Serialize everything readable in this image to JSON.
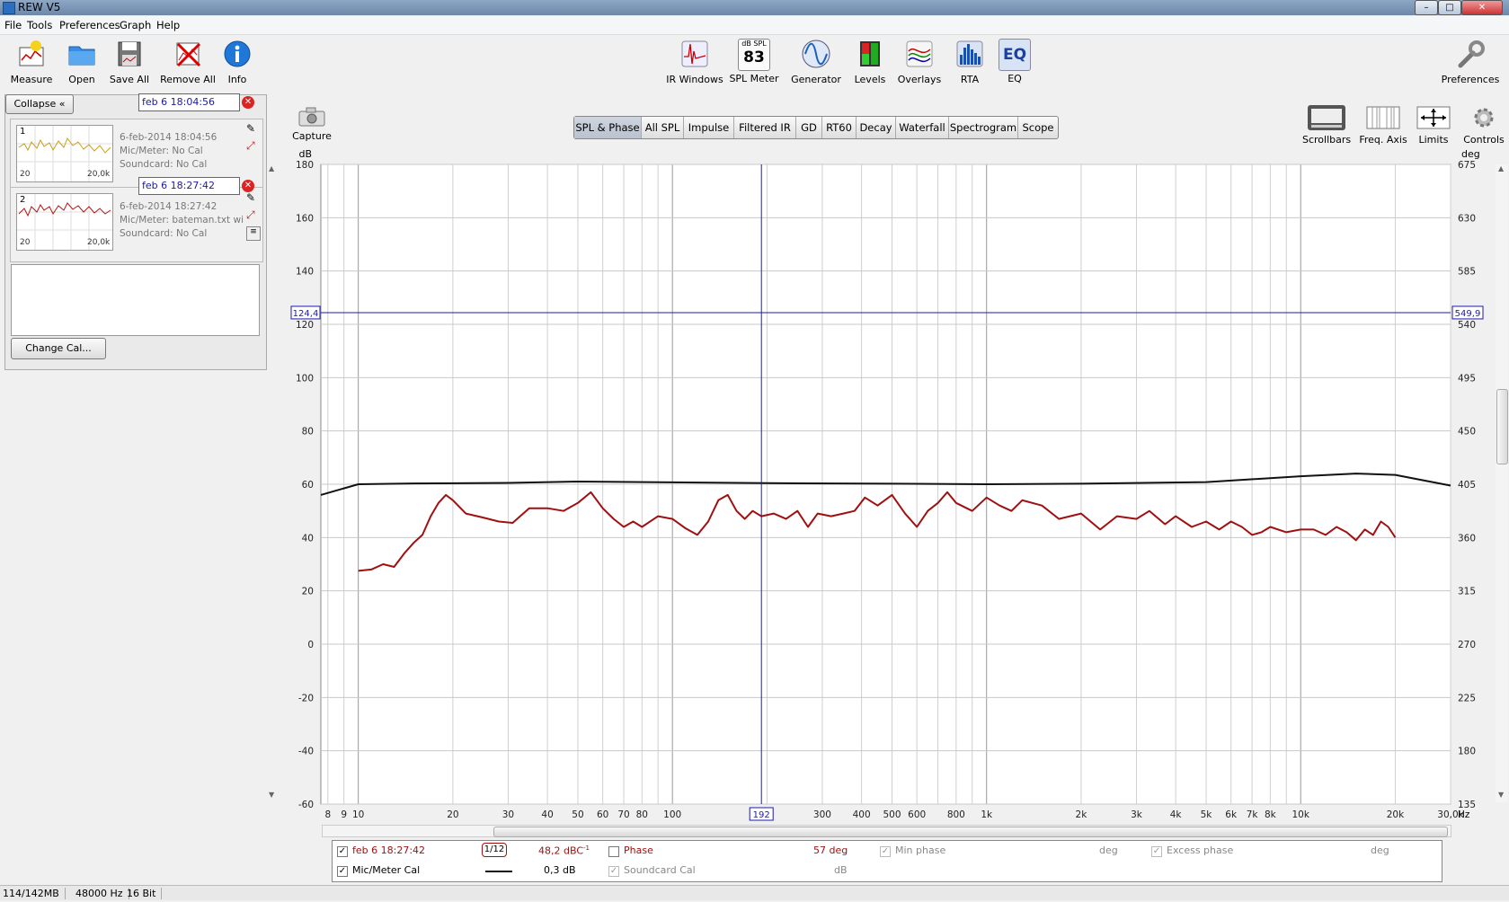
{
  "window": {
    "title": "REW V5"
  },
  "menu": [
    "File",
    "Tools",
    "Preferences",
    "Graph",
    "Help"
  ],
  "toolbar_left": [
    {
      "label": "Measure",
      "icon": "measure-icon"
    },
    {
      "label": "Open",
      "icon": "folder-icon"
    },
    {
      "label": "Save All",
      "icon": "save-icon"
    },
    {
      "label": "Remove All",
      "icon": "remove-icon"
    },
    {
      "label": "Info",
      "icon": "info-icon"
    }
  ],
  "toolbar_center": [
    {
      "label": "IR Windows",
      "icon": "ir-windows-icon"
    },
    {
      "label": "SPL Meter",
      "icon": "spl-meter-icon",
      "top": "dB SPL",
      "value": "83"
    },
    {
      "label": "Generator",
      "icon": "generator-icon"
    },
    {
      "label": "Levels",
      "icon": "levels-icon"
    },
    {
      "label": "Overlays",
      "icon": "overlays-icon"
    },
    {
      "label": "RTA",
      "icon": "rta-icon"
    },
    {
      "label": "EQ",
      "icon": "eq-icon",
      "text": "EQ"
    }
  ],
  "toolbar_right": {
    "label": "Preferences",
    "icon": "wrench-icon"
  },
  "panel": {
    "collapse_label": "Collapse",
    "change_cal_label": "Change Cal...",
    "measurements": [
      {
        "num": "1",
        "name": "feb 6 18:04:56",
        "date": "6-feb-2014 18:04:56",
        "mic": "Mic/Meter: No Cal",
        "soundcard": "Soundcard: No Cal",
        "thumb_min": "20",
        "thumb_max": "20,0k",
        "color": "#c8a020"
      },
      {
        "num": "2",
        "name": "feb 6 18:27:42",
        "date": "6-feb-2014 18:27:42",
        "mic": "Mic/Meter: bateman.txt wi",
        "soundcard": "Soundcard: No Cal",
        "thumb_min": "20",
        "thumb_max": "20,0k",
        "color": "#b01818"
      }
    ]
  },
  "capture": {
    "label": "Capture"
  },
  "graph_tabs": [
    "SPL & Phase",
    "All SPL",
    "Impulse",
    "Filtered IR",
    "GD",
    "RT60",
    "Decay",
    "Waterfall",
    "Spectrogram",
    "Scope"
  ],
  "graph_tabs_selected": "SPL & Phase",
  "right_controls": [
    "Scrollbars",
    "Freq. Axis",
    "Limits",
    "Controls"
  ],
  "chart_data": {
    "type": "line",
    "x_scale": "log",
    "xlim": [
      7.6,
      30000
    ],
    "ylim": [
      -60,
      180
    ],
    "y2lim": [
      135,
      675
    ],
    "ylabel": "dB",
    "y2label": "deg",
    "xunit": "Hz",
    "y_ticks": [
      180,
      160,
      140,
      120,
      100,
      80,
      60,
      40,
      20,
      0,
      -20,
      -40,
      -60
    ],
    "y2_ticks": [
      675,
      630,
      585,
      540,
      495,
      450,
      405,
      360,
      315,
      270,
      225,
      180,
      135
    ],
    "x_ticks": [
      {
        "v": 8,
        "l": "8"
      },
      {
        "v": 9,
        "l": "9"
      },
      {
        "v": 10,
        "l": "10"
      },
      {
        "v": 20,
        "l": "20"
      },
      {
        "v": 30,
        "l": "30"
      },
      {
        "v": 40,
        "l": "40"
      },
      {
        "v": 50,
        "l": "50"
      },
      {
        "v": 60,
        "l": "60"
      },
      {
        "v": 70,
        "l": "70"
      },
      {
        "v": 80,
        "l": "80"
      },
      {
        "v": 100,
        "l": "100"
      },
      {
        "v": 300,
        "l": "300"
      },
      {
        "v": 400,
        "l": "400"
      },
      {
        "v": 500,
        "l": "500"
      },
      {
        "v": 600,
        "l": "600"
      },
      {
        "v": 800,
        "l": "800"
      },
      {
        "v": 1000,
        "l": "1k"
      },
      {
        "v": 2000,
        "l": "2k"
      },
      {
        "v": 3000,
        "l": "3k"
      },
      {
        "v": 4000,
        "l": "4k"
      },
      {
        "v": 5000,
        "l": "5k"
      },
      {
        "v": 6000,
        "l": "6k"
      },
      {
        "v": 7000,
        "l": "7k"
      },
      {
        "v": 8000,
        "l": "8k"
      },
      {
        "v": 10000,
        "l": "10k"
      },
      {
        "v": 20000,
        "l": "20k"
      },
      {
        "v": 30000,
        "l": "30,0k"
      }
    ],
    "cursor": {
      "x": 192,
      "x_label": "192",
      "y": 124.4,
      "y_label": "124,4",
      "y2_label": "549,9"
    },
    "series": [
      {
        "name": "Mic/Meter Cal",
        "color": "#111111",
        "x": [
          7.6,
          10,
          15,
          30,
          50,
          100,
          200,
          500,
          1000,
          2000,
          5000,
          10000,
          15000,
          20000,
          30000
        ],
        "y": [
          56,
          60,
          60.3,
          60.5,
          61,
          60.7,
          60.4,
          60.2,
          60,
          60.2,
          60.8,
          63,
          64,
          63.5,
          59.5
        ]
      },
      {
        "name": "feb 6 18:27:42",
        "color": "#a01010",
        "x": [
          10,
          11,
          12,
          13,
          14,
          15,
          16,
          17,
          18,
          19,
          20,
          22,
          25,
          28,
          31,
          35,
          40,
          45,
          50,
          55,
          60,
          65,
          70,
          75,
          80,
          90,
          100,
          110,
          120,
          130,
          140,
          150,
          160,
          170,
          180,
          192,
          210,
          230,
          250,
          270,
          290,
          320,
          350,
          380,
          410,
          450,
          500,
          550,
          600,
          650,
          700,
          750,
          800,
          900,
          1000,
          1100,
          1200,
          1300,
          1500,
          1700,
          2000,
          2300,
          2600,
          3000,
          3300,
          3700,
          4000,
          4500,
          5000,
          5500,
          6000,
          6500,
          7000,
          7500,
          8000,
          9000,
          10000,
          11000,
          12000,
          13000,
          14000,
          15000,
          16000,
          17000,
          18000,
          19000,
          20000
        ],
        "y": [
          27.5,
          28,
          30,
          29,
          34,
          38,
          41,
          48,
          53,
          56,
          54,
          49,
          47.5,
          46,
          45.5,
          51,
          51,
          50,
          53,
          57,
          51,
          47,
          44,
          46,
          44,
          48,
          47,
          43.5,
          41,
          46,
          54,
          56,
          50,
          47,
          50,
          48,
          49,
          47,
          50,
          44,
          49,
          48,
          49,
          50,
          55,
          52,
          56,
          49,
          44,
          50,
          53,
          57,
          53,
          50,
          55,
          52,
          50,
          54,
          52,
          47,
          49,
          43,
          48,
          47,
          50,
          45,
          48,
          44,
          46,
          43,
          46,
          44,
          41,
          42,
          44,
          42,
          43,
          43,
          41,
          44,
          42,
          39,
          43,
          41,
          46,
          44,
          40
        ]
      }
    ]
  },
  "legend": {
    "rows": [
      {
        "name": "feb 6 18:27:42",
        "smoothing": "1/12",
        "value": "48,2 dBC",
        "value_sup": "-1",
        "phase_label": "Phase",
        "phase_value": "57 deg",
        "min_phase": "Min phase",
        "min_unit": "deg",
        "excess": "Excess phase",
        "excess_unit": "deg"
      },
      {
        "name": "Mic/Meter Cal",
        "value": "0,3 dB",
        "soundcard": "Soundcard Cal",
        "soundcard_unit": "dB"
      }
    ]
  },
  "status": [
    "114/142MB",
    "48000 Hz",
    "16 Bit"
  ]
}
